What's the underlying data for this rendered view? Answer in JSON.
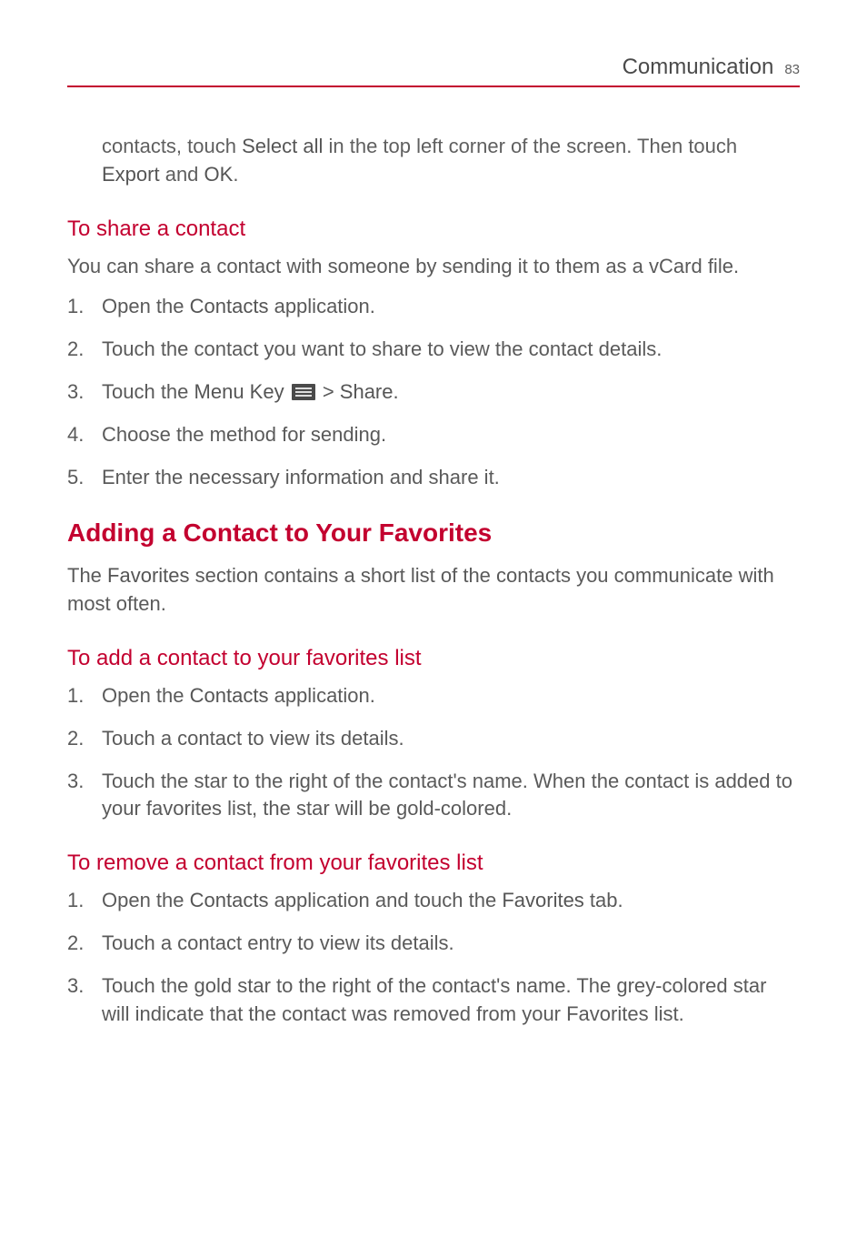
{
  "header": {
    "section": "Communication",
    "page": "83"
  },
  "intro": {
    "pre": "contacts, touch ",
    "bold1": "Select all",
    "mid1": " in the top left corner of the screen. Then touch ",
    "bold2": "Export",
    "mid2": " and ",
    "bold3": "OK",
    "post": "."
  },
  "share": {
    "heading": "To share a contact",
    "desc": "You can share a contact with someone by sending it to them as a vCard file.",
    "steps": {
      "s1_pre": "Open the ",
      "s1_bold": "Contacts",
      "s1_post": " application.",
      "s2": "Touch the contact you want to share to view the contact details.",
      "s3_pre": "Touch the ",
      "s3_bold1": "Menu Key",
      "s3_mid": " > ",
      "s3_bold2": "Share",
      "s3_post": ".",
      "s4": "Choose the method for sending.",
      "s5": "Enter the necessary information and share it."
    }
  },
  "favorites": {
    "heading": "Adding a Contact to Your Favorites",
    "desc_pre": "The ",
    "desc_bold": "Favorites",
    "desc_post": " section contains a short list of the contacts you communicate with most often.",
    "add": {
      "heading": "To add a contact to your favorites list",
      "s1_pre": "Open the ",
      "s1_bold": "Contacts",
      "s1_post": " application.",
      "s2": "Touch a contact to view its details.",
      "s3": "Touch the star to the right of the contact's name. When the contact is added to your favorites list, the star will be gold-colored."
    },
    "remove": {
      "heading": "To remove a contact from your favorites list",
      "s1_pre": "Open the ",
      "s1_bold1": "Contacts",
      "s1_mid": " application and touch the ",
      "s1_bold2": "Favorites",
      "s1_post": " tab.",
      "s2": "Touch a contact entry to view its details.",
      "s3": "Touch the gold star to the right of the contact's name. The grey-colored star will indicate that the contact was removed from your Favorites list."
    }
  }
}
